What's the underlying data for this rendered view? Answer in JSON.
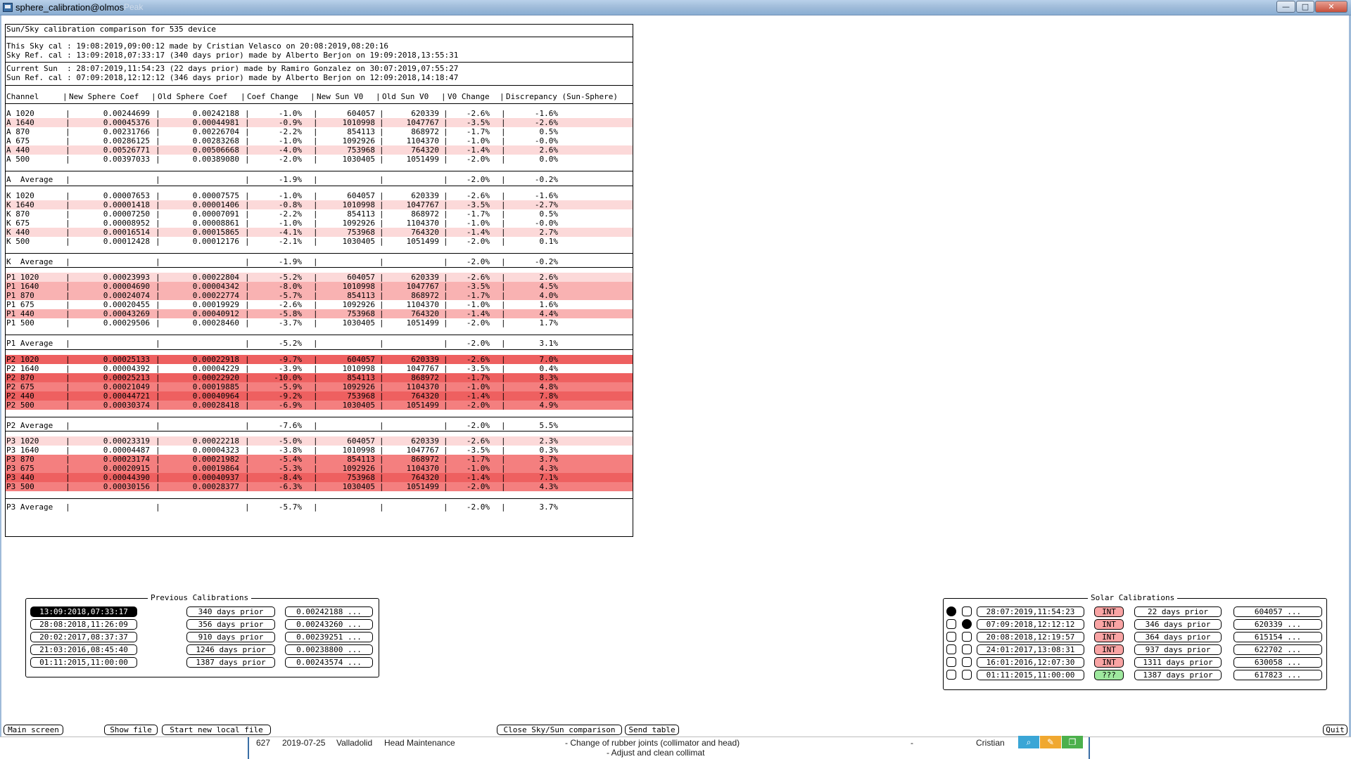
{
  "window": {
    "title": "sphere_calibration@olmos",
    "ghost_tab": "Peak",
    "controls": {
      "minimize": "—",
      "maximize": "□",
      "close": "✕"
    }
  },
  "report": {
    "header": "Sun/Sky calibration comparison for 535 device",
    "sky_lines": [
      "This Sky cal : 19:08:2019,09:00:12 made by Cristian Velasco on 20:08:2019,08:20:16",
      "Sky Ref. cal : 13:09:2018,07:33:17 (340 days prior) made by Alberto Berjon on 19:09:2018,13:55:31"
    ],
    "sun_lines": [
      "Current Sun  : 28:07:2019,11:54:23 (22 days prior) made by Ramiro Gonzalez on 30:07:2019,07:55:27",
      "Sun Ref. cal : 07:09:2018,12:12:12 (346 days prior) made by Alberto Berjon on 12:09:2018,14:18:47"
    ],
    "columns": [
      "Channel",
      "New Sphere Coef",
      "Old Sphere Coef",
      "Coef Change",
      "New Sun V0",
      "Old Sun V0",
      "V0 Change",
      "Discrepancy (Sun-Sphere)"
    ],
    "groups": [
      {
        "average_label": "A  Average",
        "average": {
          "coef_change": "-1.9%",
          "v0_change": "-2.0%",
          "discrepancy": "-0.2%"
        },
        "rows": [
          {
            "channel": "A 1020",
            "new_coef": "0.00244699",
            "old_coef": "0.00242188",
            "coef_change": "-1.0%",
            "new_v0": "604057",
            "old_v0": "620339",
            "v0_change": "-2.6%",
            "discrepancy": "-1.6%",
            "level": 0
          },
          {
            "channel": "A 1640",
            "new_coef": "0.00045376",
            "old_coef": "0.00044981",
            "coef_change": "-0.9%",
            "new_v0": "1010998",
            "old_v0": "1047767",
            "v0_change": "-3.5%",
            "discrepancy": "-2.6%",
            "level": 1
          },
          {
            "channel": "A 870",
            "new_coef": "0.00231766",
            "old_coef": "0.00226704",
            "coef_change": "-2.2%",
            "new_v0": "854113",
            "old_v0": "868972",
            "v0_change": "-1.7%",
            "discrepancy": "0.5%",
            "level": 0
          },
          {
            "channel": "A 675",
            "new_coef": "0.00286125",
            "old_coef": "0.00283268",
            "coef_change": "-1.0%",
            "new_v0": "1092926",
            "old_v0": "1104370",
            "v0_change": "-1.0%",
            "discrepancy": "-0.0%",
            "level": 0
          },
          {
            "channel": "A 440",
            "new_coef": "0.00526771",
            "old_coef": "0.00506668",
            "coef_change": "-4.0%",
            "new_v0": "753968",
            "old_v0": "764320",
            "v0_change": "-1.4%",
            "discrepancy": "2.6%",
            "level": 1
          },
          {
            "channel": "A 500",
            "new_coef": "0.00397033",
            "old_coef": "0.00389080",
            "coef_change": "-2.0%",
            "new_v0": "1030405",
            "old_v0": "1051499",
            "v0_change": "-2.0%",
            "discrepancy": "0.0%",
            "level": 0
          }
        ]
      },
      {
        "average_label": "K  Average",
        "average": {
          "coef_change": "-1.9%",
          "v0_change": "-2.0%",
          "discrepancy": "-0.2%"
        },
        "rows": [
          {
            "channel": "K 1020",
            "new_coef": "0.00007653",
            "old_coef": "0.00007575",
            "coef_change": "-1.0%",
            "new_v0": "604057",
            "old_v0": "620339",
            "v0_change": "-2.6%",
            "discrepancy": "-1.6%",
            "level": 0
          },
          {
            "channel": "K 1640",
            "new_coef": "0.00001418",
            "old_coef": "0.00001406",
            "coef_change": "-0.8%",
            "new_v0": "1010998",
            "old_v0": "1047767",
            "v0_change": "-3.5%",
            "discrepancy": "-2.7%",
            "level": 1
          },
          {
            "channel": "K 870",
            "new_coef": "0.00007250",
            "old_coef": "0.00007091",
            "coef_change": "-2.2%",
            "new_v0": "854113",
            "old_v0": "868972",
            "v0_change": "-1.7%",
            "discrepancy": "0.5%",
            "level": 0
          },
          {
            "channel": "K 675",
            "new_coef": "0.00008952",
            "old_coef": "0.00008861",
            "coef_change": "-1.0%",
            "new_v0": "1092926",
            "old_v0": "1104370",
            "v0_change": "-1.0%",
            "discrepancy": "-0.0%",
            "level": 0
          },
          {
            "channel": "K 440",
            "new_coef": "0.00016514",
            "old_coef": "0.00015865",
            "coef_change": "-4.1%",
            "new_v0": "753968",
            "old_v0": "764320",
            "v0_change": "-1.4%",
            "discrepancy": "2.7%",
            "level": 1
          },
          {
            "channel": "K 500",
            "new_coef": "0.00012428",
            "old_coef": "0.00012176",
            "coef_change": "-2.1%",
            "new_v0": "1030405",
            "old_v0": "1051499",
            "v0_change": "-2.0%",
            "discrepancy": "0.1%",
            "level": 0
          }
        ]
      },
      {
        "average_label": "P1 Average",
        "average": {
          "coef_change": "-5.2%",
          "v0_change": "-2.0%",
          "discrepancy": "3.1%"
        },
        "rows": [
          {
            "channel": "P1 1020",
            "new_coef": "0.00023993",
            "old_coef": "0.00022804",
            "coef_change": "-5.2%",
            "new_v0": "604057",
            "old_v0": "620339",
            "v0_change": "-2.6%",
            "discrepancy": "2.6%",
            "level": 1
          },
          {
            "channel": "P1 1640",
            "new_coef": "0.00004690",
            "old_coef": "0.00004342",
            "coef_change": "-8.0%",
            "new_v0": "1010998",
            "old_v0": "1047767",
            "v0_change": "-3.5%",
            "discrepancy": "4.5%",
            "level": 2
          },
          {
            "channel": "P1 870",
            "new_coef": "0.00024074",
            "old_coef": "0.00022774",
            "coef_change": "-5.7%",
            "new_v0": "854113",
            "old_v0": "868972",
            "v0_change": "-1.7%",
            "discrepancy": "4.0%",
            "level": 2
          },
          {
            "channel": "P1 675",
            "new_coef": "0.00020455",
            "old_coef": "0.00019929",
            "coef_change": "-2.6%",
            "new_v0": "1092926",
            "old_v0": "1104370",
            "v0_change": "-1.0%",
            "discrepancy": "1.6%",
            "level": 0
          },
          {
            "channel": "P1 440",
            "new_coef": "0.00043269",
            "old_coef": "0.00040912",
            "coef_change": "-5.8%",
            "new_v0": "753968",
            "old_v0": "764320",
            "v0_change": "-1.4%",
            "discrepancy": "4.4%",
            "level": 2
          },
          {
            "channel": "P1 500",
            "new_coef": "0.00029506",
            "old_coef": "0.00028460",
            "coef_change": "-3.7%",
            "new_v0": "1030405",
            "old_v0": "1051499",
            "v0_change": "-2.0%",
            "discrepancy": "1.7%",
            "level": 0
          }
        ]
      },
      {
        "average_label": "P2 Average",
        "average": {
          "coef_change": "-7.6%",
          "v0_change": "-2.0%",
          "discrepancy": "5.5%"
        },
        "rows": [
          {
            "channel": "P2 1020",
            "new_coef": "0.00025133",
            "old_coef": "0.00022918",
            "coef_change": "-9.7%",
            "new_v0": "604057",
            "old_v0": "620339",
            "v0_change": "-2.6%",
            "discrepancy": "7.0%",
            "level": 4
          },
          {
            "channel": "P2 1640",
            "new_coef": "0.00004392",
            "old_coef": "0.00004229",
            "coef_change": "-3.9%",
            "new_v0": "1010998",
            "old_v0": "1047767",
            "v0_change": "-3.5%",
            "discrepancy": "0.4%",
            "level": 0
          },
          {
            "channel": "P2 870",
            "new_coef": "0.00025213",
            "old_coef": "0.00022920",
            "coef_change": "-10.0%",
            "new_v0": "854113",
            "old_v0": "868972",
            "v0_change": "-1.7%",
            "discrepancy": "8.3%",
            "level": 4
          },
          {
            "channel": "P2 675",
            "new_coef": "0.00021049",
            "old_coef": "0.00019885",
            "coef_change": "-5.9%",
            "new_v0": "1092926",
            "old_v0": "1104370",
            "v0_change": "-1.0%",
            "discrepancy": "4.8%",
            "level": 3
          },
          {
            "channel": "P2 440",
            "new_coef": "0.00044721",
            "old_coef": "0.00040964",
            "coef_change": "-9.2%",
            "new_v0": "753968",
            "old_v0": "764320",
            "v0_change": "-1.4%",
            "discrepancy": "7.8%",
            "level": 4
          },
          {
            "channel": "P2 500",
            "new_coef": "0.00030374",
            "old_coef": "0.00028418",
            "coef_change": "-6.9%",
            "new_v0": "1030405",
            "old_v0": "1051499",
            "v0_change": "-2.0%",
            "discrepancy": "4.9%",
            "level": 3
          }
        ]
      },
      {
        "average_label": "P3 Average",
        "average": {
          "coef_change": "-5.7%",
          "v0_change": "-2.0%",
          "discrepancy": "3.7%"
        },
        "rows": [
          {
            "channel": "P3 1020",
            "new_coef": "0.00023319",
            "old_coef": "0.00022218",
            "coef_change": "-5.0%",
            "new_v0": "604057",
            "old_v0": "620339",
            "v0_change": "-2.6%",
            "discrepancy": "2.3%",
            "level": 1
          },
          {
            "channel": "P3 1640",
            "new_coef": "0.00004487",
            "old_coef": "0.00004323",
            "coef_change": "-3.8%",
            "new_v0": "1010998",
            "old_v0": "1047767",
            "v0_change": "-3.5%",
            "discrepancy": "0.3%",
            "level": 0
          },
          {
            "channel": "P3 870",
            "new_coef": "0.00023174",
            "old_coef": "0.00021982",
            "coef_change": "-5.4%",
            "new_v0": "854113",
            "old_v0": "868972",
            "v0_change": "-1.7%",
            "discrepancy": "3.7%",
            "level": 3
          },
          {
            "channel": "P3 675",
            "new_coef": "0.00020915",
            "old_coef": "0.00019864",
            "coef_change": "-5.3%",
            "new_v0": "1092926",
            "old_v0": "1104370",
            "v0_change": "-1.0%",
            "discrepancy": "4.3%",
            "level": 3
          },
          {
            "channel": "P3 440",
            "new_coef": "0.00044390",
            "old_coef": "0.00040937",
            "coef_change": "-8.4%",
            "new_v0": "753968",
            "old_v0": "764320",
            "v0_change": "-1.4%",
            "discrepancy": "7.1%",
            "level": 4
          },
          {
            "channel": "P3 500",
            "new_coef": "0.00030156",
            "old_coef": "0.00028377",
            "coef_change": "-6.3%",
            "new_v0": "1030405",
            "old_v0": "1051499",
            "v0_change": "-2.0%",
            "discrepancy": "4.3%",
            "level": 3
          }
        ]
      }
    ],
    "row_colors": {
      "level_0": "#ffffff",
      "level_1": "#fcd9d9",
      "level_2": "#f9b2b2",
      "level_3": "#f47f7f",
      "level_4": "#ee6060"
    }
  },
  "previous_calibrations": {
    "title": "Previous Calibrations",
    "items": [
      {
        "date": "13:09:2018,07:33:17",
        "prior": "340 days prior",
        "coef": "0.00242188 ...",
        "selected": true
      },
      {
        "date": "28:08:2018,11:26:09",
        "prior": "356 days prior",
        "coef": "0.00243260 ...",
        "selected": false
      },
      {
        "date": "20:02:2017,08:37:37",
        "prior": "910 days prior",
        "coef": "0.00239251 ...",
        "selected": false
      },
      {
        "date": "21:03:2016,08:45:40",
        "prior": "1246 days prior",
        "coef": "0.00238800 ...",
        "selected": false
      },
      {
        "date": "01:11:2015,11:00:00",
        "prior": "1387 days prior",
        "coef": "0.00243574 ...",
        "selected": false
      }
    ]
  },
  "solar_calibrations": {
    "title": "Solar Calibrations",
    "items": [
      {
        "current": true,
        "reference": false,
        "date": "28:07:2019,11:54:23",
        "type": "INT",
        "prior": "22 days prior",
        "v0": "604057 ..."
      },
      {
        "current": false,
        "reference": true,
        "date": "07:09:2018,12:12:12",
        "type": "INT",
        "prior": "346 days prior",
        "v0": "620339 ..."
      },
      {
        "current": false,
        "reference": false,
        "date": "20:08:2018,12:19:57",
        "type": "INT",
        "prior": "364 days prior",
        "v0": "615154 ..."
      },
      {
        "current": false,
        "reference": false,
        "date": "24:01:2017,13:08:31",
        "type": "INT",
        "prior": "937 days prior",
        "v0": "622702 ..."
      },
      {
        "current": false,
        "reference": false,
        "date": "16:01:2016,12:07:30",
        "type": "INT",
        "prior": "1311 days prior",
        "v0": "630058 ..."
      },
      {
        "current": false,
        "reference": false,
        "date": "01:11:2015,11:00:00",
        "type": "???",
        "prior": "1387 days prior",
        "v0": "617823 ..."
      }
    ]
  },
  "buttons": {
    "main_screen": "Main screen",
    "show_file": "Show file",
    "start_new_local_file": "Start new local file",
    "close_comparison": "Close Sky/Sun comparison",
    "send_table": "Send table",
    "quit": "Quit"
  },
  "statusbar": {
    "id": "627",
    "date": "2019-07-25",
    "place": "Valladolid",
    "type": "Head Maintenance",
    "desc_line1": "- Change of rubber joints (collimator and head)",
    "desc_line2": "- Adjust and clean collimat",
    "dash": "-",
    "user": "Cristian",
    "icons": [
      "search-icon",
      "edit-icon",
      "copy-icon"
    ],
    "icon_colors": [
      "#3aa6d6",
      "#f0a830",
      "#4cb04c"
    ]
  }
}
